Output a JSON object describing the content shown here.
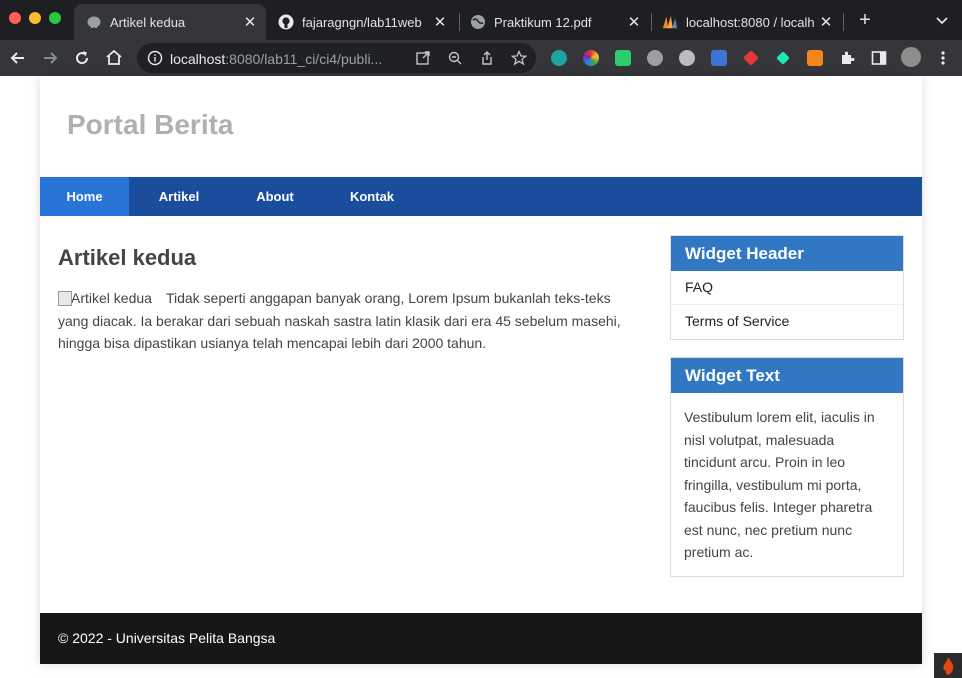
{
  "browser": {
    "tabs": [
      {
        "title": "Artikel kedua",
        "active": true,
        "icon": "elephant-favicon-icon"
      },
      {
        "title": "fajaragngn/lab11web",
        "active": false,
        "icon": "github-icon"
      },
      {
        "title": "Praktikum 12.pdf",
        "active": false,
        "icon": "globe-icon"
      },
      {
        "title": "localhost:8080 / localh",
        "active": false,
        "icon": "phpmyadmin-icon"
      }
    ],
    "url_host": "localhost",
    "url_rest": ":8080/lab11_ci/ci4/publi...",
    "colors": {
      "tabbar": "#1e1f22",
      "toolbar": "#35363a",
      "omnibox": "#202124"
    }
  },
  "site": {
    "title": "Portal Berita",
    "nav": [
      "Home",
      "Artikel",
      "About",
      "Kontak"
    ],
    "active_nav": "Home",
    "colors": {
      "nav": "#1a4e9c",
      "nav_active": "#2a74d8",
      "widget_header": "#3277c2",
      "footer": "#171717"
    }
  },
  "article": {
    "title": "Artikel kedua",
    "image_alt": "Artikel kedua",
    "body": "Tidak seperti anggapan banyak orang, Lorem Ipsum bukanlah teks-teks yang diacak. Ia berakar dari sebuah naskah sastra latin klasik dari era 45 sebelum masehi, hingga bisa dipastikan usianya telah mencapai lebih dari 2000 tahun."
  },
  "widgets": {
    "links": {
      "header": "Widget Header",
      "items": [
        "FAQ",
        "Terms of Service"
      ]
    },
    "text": {
      "header": "Widget Text",
      "body": "Vestibulum lorem elit, iaculis in nisl volutpat, malesuada tincidunt arcu. Proin in leo fringilla, vestibulum mi porta, faucibus felis. Integer pharetra est nunc, nec pretium nunc pretium ac."
    }
  },
  "footer": {
    "text": "© 2022 - Universitas Pelita Bangsa"
  }
}
